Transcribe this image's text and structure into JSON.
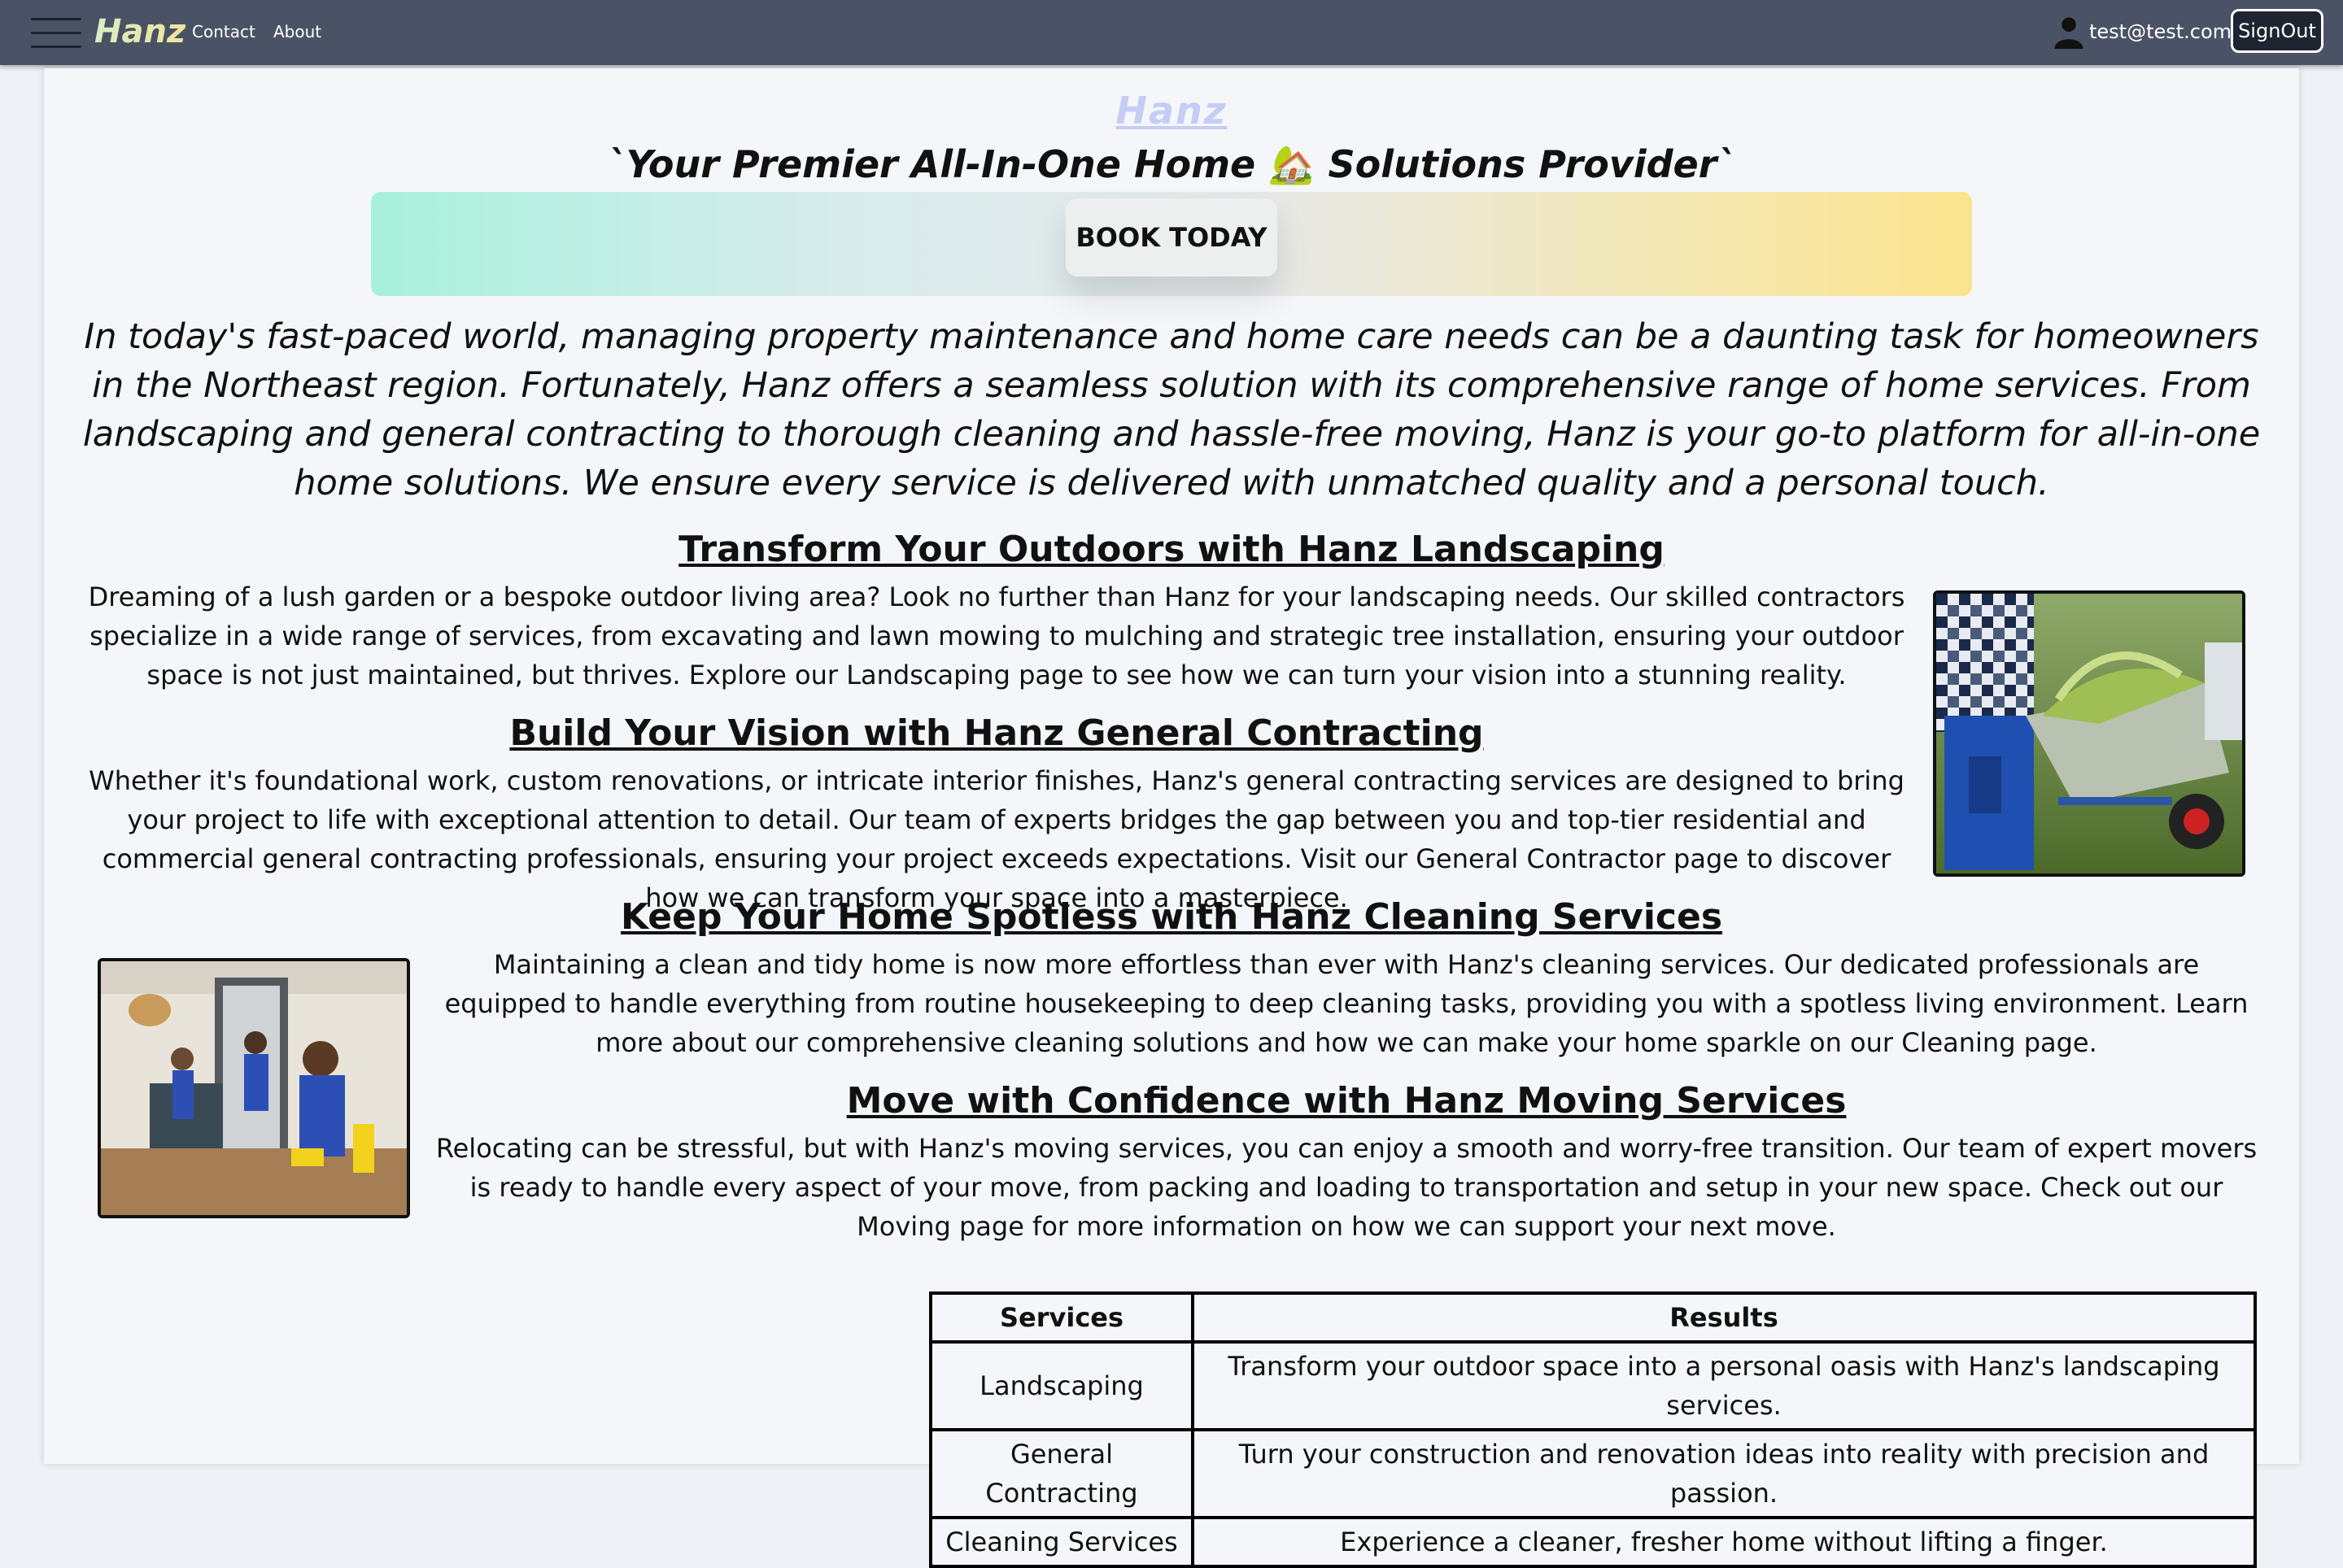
{
  "navbar": {
    "brand": "Hanz",
    "links": {
      "contact": "Contact",
      "about": "About"
    },
    "user_email": "test@test.com",
    "signout_label": "SignOut",
    "brand_gradient": [
      "#d7efc4",
      "#f3e29c"
    ],
    "bg_color": "#4a5366"
  },
  "hero": {
    "title": "Hanz",
    "tagline": "`Your Premier All-In-One Home 🏡 Solutions Provider`",
    "book_button": "BOOK TODAY",
    "banner_gradient": [
      "#a8f0dc",
      "#fbe48e"
    ]
  },
  "intro": "In today's fast-paced world, managing property maintenance and home care needs can be a daunting task for homeowners in the Northeast region. Fortunately, Hanz offers a seamless solution with its comprehensive range of home services. From landscaping and general contracting to thorough cleaning and hassle-free moving, Hanz is your go-to platform for all-in-one home solutions. We ensure every service is delivered with unmatched quality and a personal touch.",
  "sections": {
    "landscaping": {
      "heading": "Transform Your Outdoors with Hanz Landscaping",
      "text": "Dreaming of a lush garden or a bespoke outdoor living area? Look no further than Hanz for your landscaping needs. Our skilled contractors specialize in a wide range of services, from excavating and lawn mowing to mulching and strategic tree installation, ensuring your outdoor space is not just maintained, but thrives. Explore our Landscaping page to see how we can turn your vision into a stunning reality."
    },
    "contracting": {
      "heading": "Build Your Vision with Hanz General Contracting",
      "text": "Whether it's foundational work, custom renovations, or intricate interior finishes, Hanz's general contracting services are designed to bring your project to life with exceptional attention to detail. Our team of experts bridges the gap between you and top-tier residential and commercial general contracting professionals, ensuring your project exceeds expectations. Visit our General Contractor page to discover how we can transform your space into a masterpiece."
    },
    "cleaning": {
      "heading": "Keep Your Home Spotless with Hanz Cleaning Services",
      "text": "Maintaining a clean and tidy home is now more effortless than ever with Hanz's cleaning services. Our dedicated professionals are equipped to handle everything from routine housekeeping to deep cleaning tasks, providing you with a spotless living environment. Learn more about our comprehensive cleaning solutions and how we can make your home sparkle on our Cleaning page."
    },
    "moving": {
      "heading": "Move with Confidence with Hanz Moving Services",
      "text": "Relocating can be stressful, but with Hanz's moving services, you can enjoy a smooth and worry-free transition. Our team of expert movers is ready to handle every aspect of your move, from packing and loading to transportation and setup in your new space. Check out our Moving page for more information on how we can support your next move."
    }
  },
  "table": {
    "headers": [
      "Services",
      "Results"
    ],
    "rows": [
      [
        "Landscaping",
        "Transform your outdoor space into a personal oasis with Hanz's landscaping services."
      ],
      [
        "General Contracting",
        "Turn your construction and renovation ideas into reality with precision and passion."
      ],
      [
        "Cleaning Services",
        "Experience a cleaner, fresher home without lifting a finger."
      ]
    ]
  }
}
